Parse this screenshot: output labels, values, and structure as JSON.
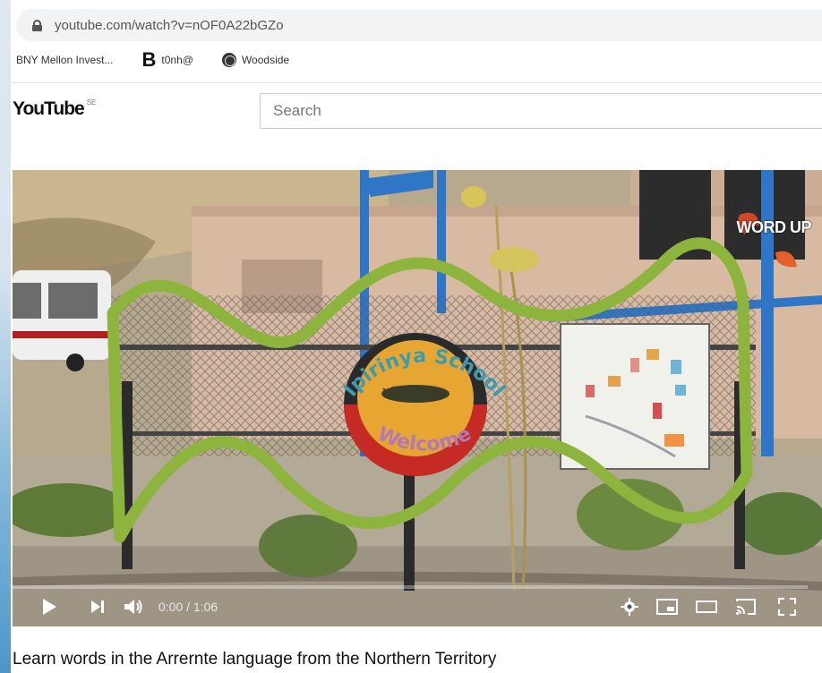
{
  "browser": {
    "url": "youtube.com/watch?v=nOF0A22bGZo",
    "bookmarks": [
      {
        "label": "BNY Mellon Invest...",
        "icon": "none"
      },
      {
        "label": "t0nh@",
        "icon": "b-icon",
        "glyph": "B"
      },
      {
        "label": "Woodside",
        "icon": "globe-icon"
      }
    ]
  },
  "youtube": {
    "logo_text": "YouTube",
    "region_code": "SE",
    "search_placeholder": "Search"
  },
  "video": {
    "sign_top_text": "Ipirinya School",
    "sign_bottom_text": "Welcome",
    "watermark_text": "WORD UP",
    "time_display": "0:00 / 1:06",
    "progress": 0.0,
    "title": "Learn words in the Arrernte language from the Northern Territory"
  },
  "colors": {
    "accent_red": "#ff0000",
    "sign_green": "#8db43c",
    "sign_teal": "#3d9bb0"
  }
}
